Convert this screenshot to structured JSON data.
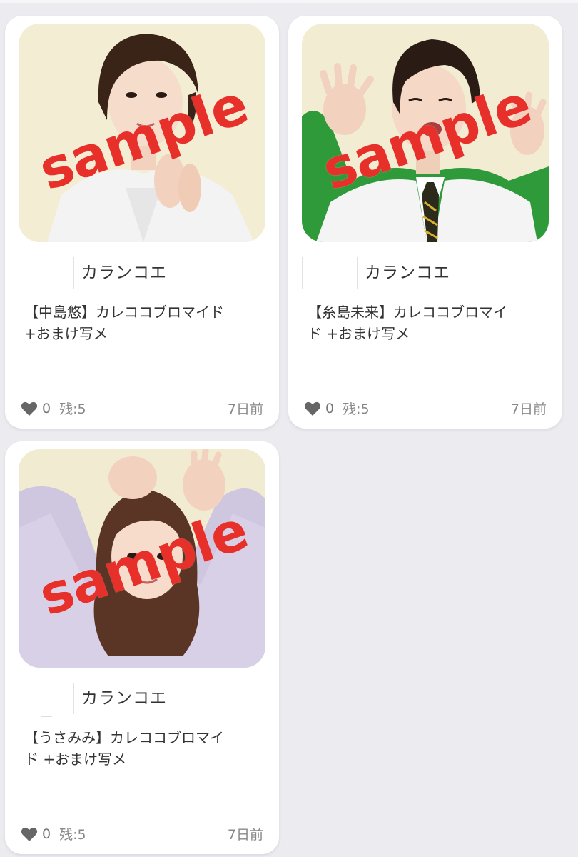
{
  "items": [
    {
      "shop": "カランコエ",
      "title": "【中島悠】カレココブロマイド\n+おまけ写メ",
      "watermark": "sample",
      "likes": "0",
      "stock": "残:5",
      "date": "7日前"
    },
    {
      "shop": "カランコエ",
      "title": "【糸島未来】カレココブロマイ\nド +おまけ写メ",
      "watermark": "sample",
      "likes": "0",
      "stock": "残:5",
      "date": "7日前"
    },
    {
      "shop": "カランコエ",
      "title": "【うさみみ】カレココブロマイ\nド +おまけ写メ",
      "watermark": "sample",
      "likes": "0",
      "stock": "残:5",
      "date": "7日前"
    }
  ],
  "colors": {
    "watermark": "#e8302a",
    "background": "#ebebf0",
    "card": "#ffffff",
    "text": "#333333",
    "muted": "#888888"
  },
  "icons": {
    "like": "heart-icon"
  }
}
